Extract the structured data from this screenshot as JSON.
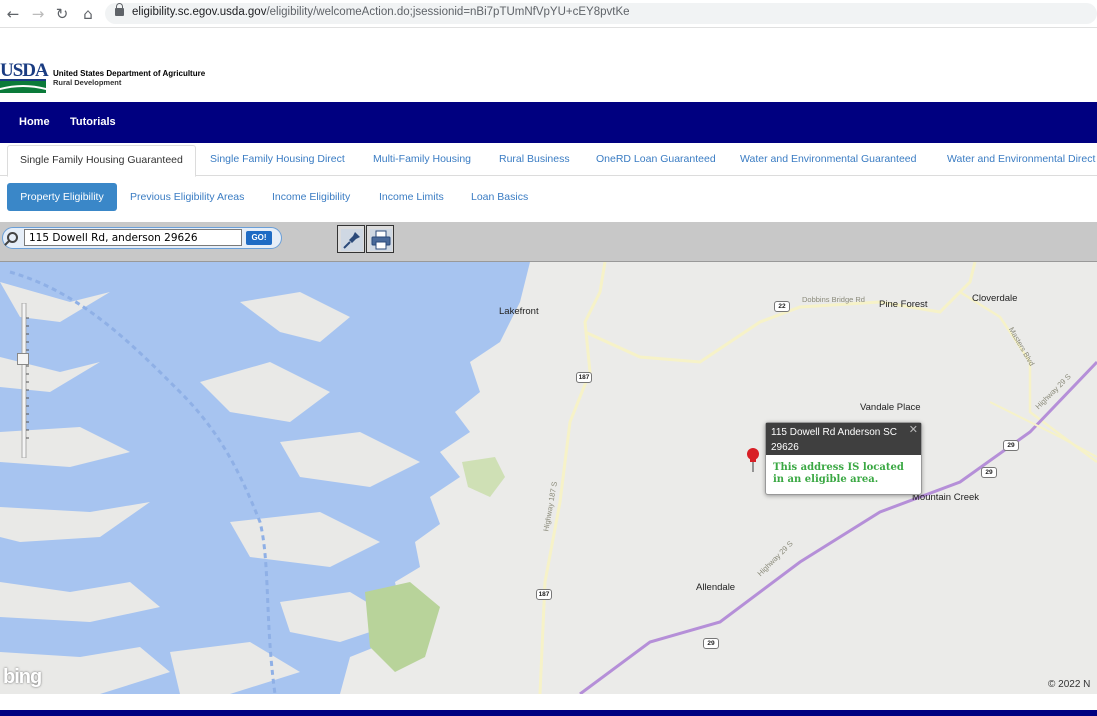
{
  "browser": {
    "url_host": "eligibility.sc.egov.usda.gov",
    "url_path": "/eligibility/welcomeAction.do;jsessionid=nBi7pTUmNfVpYU+cEY8pvtKe"
  },
  "header": {
    "logo_text": "USDA",
    "dept_name": "United States Department of Agriculture",
    "dept_sub": "Rural Development"
  },
  "nav": {
    "items": [
      "Home",
      "Tutorials"
    ]
  },
  "program_tabs": [
    "Single Family Housing Guaranteed",
    "Single Family Housing Direct",
    "Multi-Family Housing",
    "Rural Business",
    "OneRD Loan Guaranteed",
    "Water and Environmental Guaranteed",
    "Water and Environmental Direct"
  ],
  "sub_tabs": [
    "Property Eligibility",
    "Previous Eligibility Areas",
    "Income Eligibility",
    "Income Limits",
    "Loan Basics"
  ],
  "search": {
    "value": "115 Dowell Rd, anderson 29626",
    "go_label": "GO!"
  },
  "map": {
    "places": [
      "Lakefront",
      "Pine Forest",
      "Cloverdale",
      "Vandale Place",
      "Mountain Creek",
      "Allendale"
    ],
    "roads": [
      "Dobbins Bridge Rd",
      "Masters Blvd",
      "Highway 29 S",
      "Highway 187 S"
    ],
    "route_shields": [
      "22",
      "187",
      "29",
      "29",
      "187",
      "29"
    ],
    "popup": {
      "title": "115 Dowell Rd Anderson SC 29626",
      "message": "This address IS located in an eligible area."
    },
    "attribution": "bing",
    "copyright": "© 2022 N"
  },
  "colors": {
    "nav_bg": "#000080",
    "active_tab": "#3a87c8",
    "link": "#3a7cc3",
    "water": "#a7c4f0",
    "land": "#ebebe9",
    "eligible_text": "#3aa843"
  },
  "icons": [
    "back-icon",
    "forward-icon",
    "reload-icon",
    "home-icon",
    "lock-icon",
    "search-icon",
    "pushpin-icon",
    "printer-icon",
    "map-pin-icon",
    "close-icon"
  ]
}
